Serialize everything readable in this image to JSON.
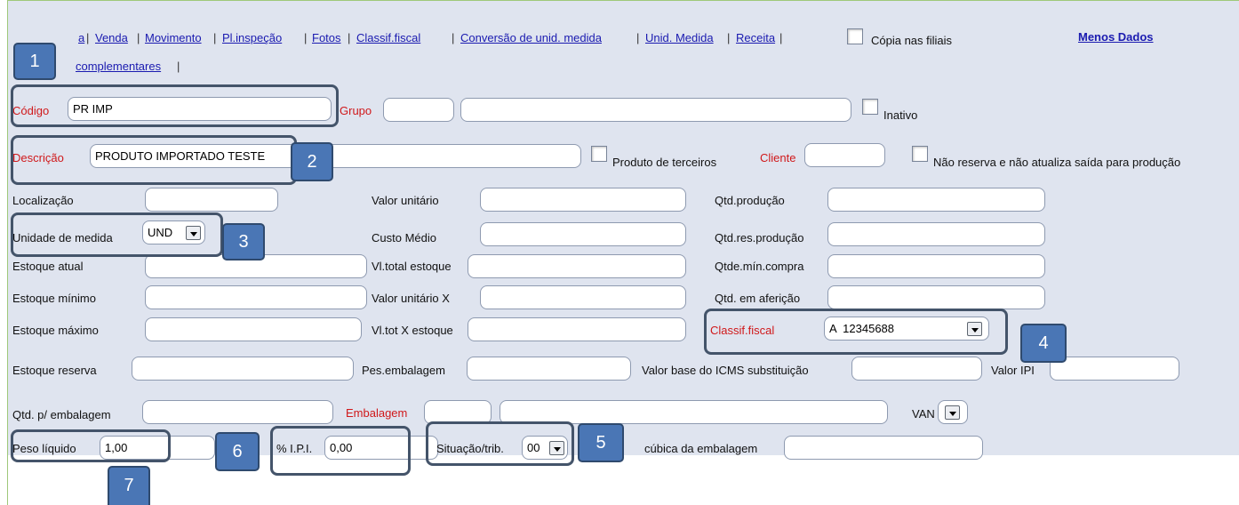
{
  "nav": {
    "items": [
      "Geral",
      "Venda",
      "Movimento",
      "Pl.inspeção",
      "Fotos",
      "Classif.fiscal",
      "Conversão de unid. medida",
      "Unid. Medida",
      "Receita",
      "Dados complementares"
    ],
    "visible_fragments": {
      "item0_tail": "a",
      "item9_tail": "complementares"
    },
    "menos_dados": "Menos Dados"
  },
  "copia_filiais": {
    "label": "Cópia nas filiais",
    "checked": false
  },
  "fields": {
    "codigo": {
      "label": "Código",
      "value": "PR IMP"
    },
    "grupo": {
      "label": "Grupo",
      "code": "",
      "name": ""
    },
    "inativo": {
      "label": "Inativo",
      "checked": false
    },
    "descricao": {
      "label": "Descrição",
      "value": "PRODUTO IMPORTADO TESTE"
    },
    "produto_terceiros": {
      "label": "Produto de terceiros",
      "checked": false
    },
    "cliente": {
      "label": "Cliente",
      "value": ""
    },
    "nao_reserva": {
      "label": "Não reserva e não atualiza saída para produção",
      "checked": false
    },
    "localizacao": {
      "label": "Localização",
      "value": ""
    },
    "valor_unitario": {
      "label": "Valor unitário",
      "value": ""
    },
    "qtd_producao": {
      "label": "Qtd.produção",
      "value": ""
    },
    "unidade_medida": {
      "label": "Unidade de medida",
      "value": "UND"
    },
    "custo_medio": {
      "label": "Custo Médio",
      "value": ""
    },
    "qtd_res_producao": {
      "label": "Qtd.res.produção",
      "value": ""
    },
    "estoque_atual": {
      "label": "Estoque atual",
      "value": ""
    },
    "vl_total_estoque": {
      "label": "Vl.total estoque",
      "value": ""
    },
    "qtde_min_compra": {
      "label": "Qtde.mín.compra",
      "value": ""
    },
    "estoque_minimo": {
      "label": "Estoque mínimo",
      "value": ""
    },
    "valor_unitario_x": {
      "label": "Valor unitário X",
      "value": ""
    },
    "qtd_afericao": {
      "label": "Qtd. em aferição",
      "value": ""
    },
    "estoque_maximo": {
      "label": "Estoque máximo",
      "value": ""
    },
    "vl_tot_x_estoque": {
      "label": "Vl.tot X estoque",
      "value": ""
    },
    "classif_fiscal": {
      "label": "Classif.fiscal",
      "value": "A  12345688"
    },
    "estoque_reserva": {
      "label": "Estoque reserva",
      "value": ""
    },
    "pes_embalagem": {
      "label": "Pes.embalagem",
      "value": ""
    },
    "valor_base_icms": {
      "label": "Valor base do ICMS substituição",
      "value": ""
    },
    "valor_ipi": {
      "label": "Valor IPI",
      "value": ""
    },
    "qtd_embalagem": {
      "label": "Qtd. p/ embalagem",
      "value": ""
    },
    "embalagem": {
      "label": "Embalagem",
      "code": "",
      "name": ""
    },
    "van": {
      "label": "VAN",
      "value": ""
    },
    "peso_liquido": {
      "label": "Peso líquido",
      "value": "1,00"
    },
    "ipi_percent": {
      "label": "% I.P.I.",
      "value": "0,00"
    },
    "situacao_trib": {
      "label": "Situação/trib.",
      "value": "00"
    },
    "cubica_embalagem": {
      "label": "cúbica da embalagem",
      "value": ""
    }
  },
  "callouts": [
    "1",
    "2",
    "3",
    "4",
    "5",
    "6",
    "7"
  ],
  "colors": {
    "form_bg": "#dfe4ef",
    "required_label": "#d0181a",
    "link": "#1a1ab0",
    "callout_fill": "#4a76b5",
    "callout_border": "#44546a"
  }
}
